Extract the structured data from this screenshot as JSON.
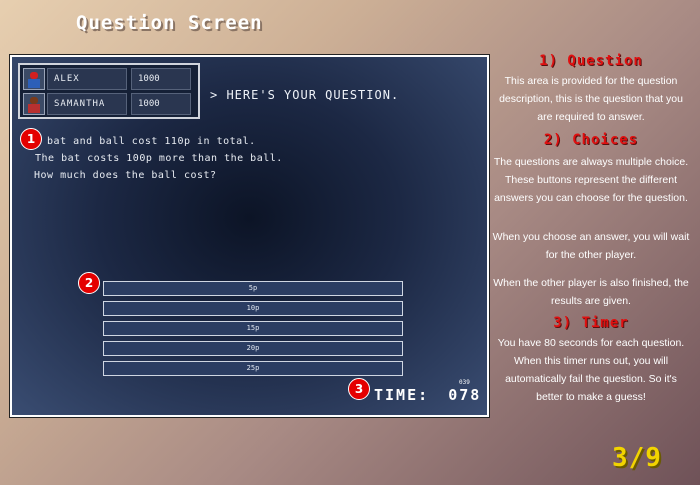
{
  "title": "Question Screen",
  "players": [
    {
      "name": "ALEX",
      "score": "1000"
    },
    {
      "name": "SAMANTHA",
      "score": "1000"
    }
  ],
  "prompt": "> HERE'S YOUR QUESTION.",
  "question": {
    "lines": [
      "A bat and ball cost 110p in total.",
      "The bat costs 100p more than the ball.",
      "How much does the ball cost?"
    ]
  },
  "choices": [
    "5p",
    "10p",
    "15p",
    "20p",
    "25p"
  ],
  "timer": {
    "label": "TIME:",
    "value": "078",
    "small": "039"
  },
  "markers": [
    "1",
    "2",
    "3"
  ],
  "sections": [
    {
      "heading": "1) Question",
      "paragraphs": [
        "This area is provided for the question description, this is the question that you are required to answer."
      ]
    },
    {
      "heading": "2) Choices",
      "paragraphs": [
        "The questions are always multiple choice. These buttons represent the different answers you can choose for the question.",
        "When you choose an answer, you will wait for the other player.",
        "When the other player is also finished, the results are given."
      ]
    },
    {
      "heading": "3) Timer",
      "paragraphs": [
        "You have 80 seconds for each question. When this timer runs out, you will automatically fail the question. So it's better to make a guess!"
      ]
    }
  ],
  "page_counter": "3/9",
  "colors": {
    "accent_red": "#e01010",
    "counter_yellow": "#f2d400",
    "panel_dark": "#0c1426"
  }
}
